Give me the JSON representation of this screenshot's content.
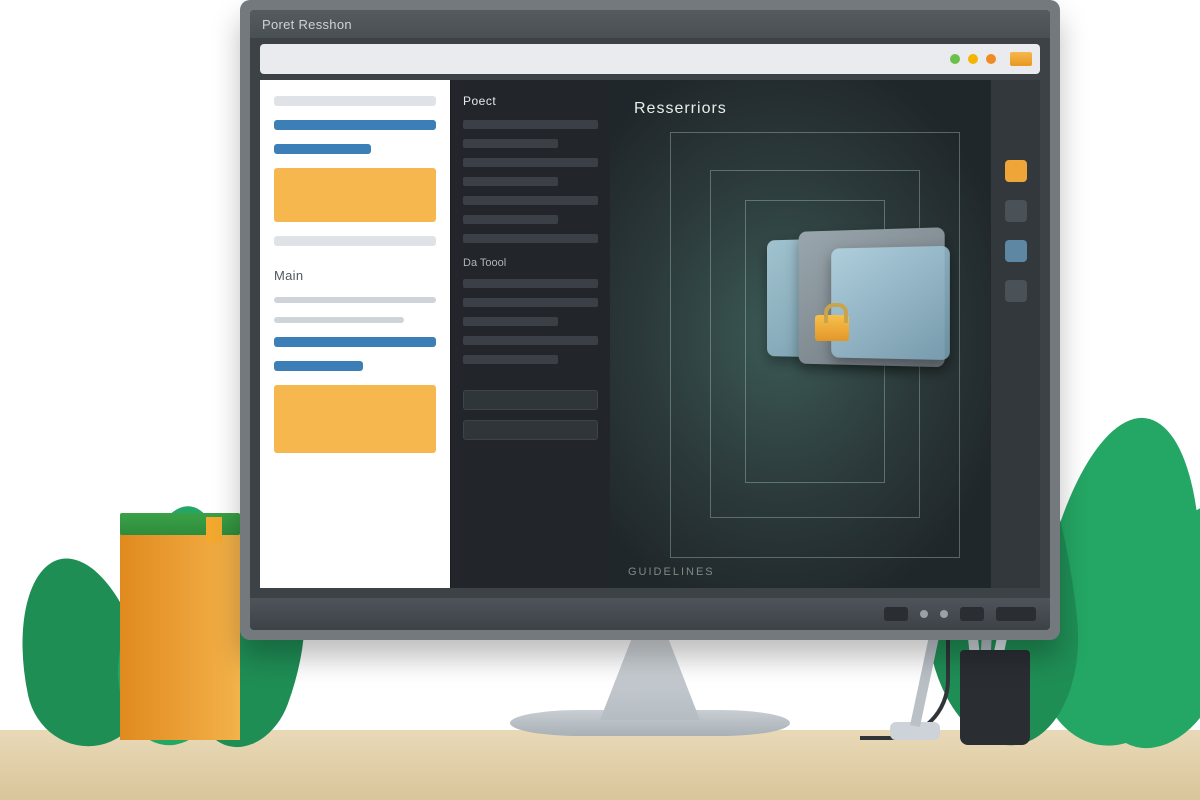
{
  "window": {
    "title": "Poret Resshon"
  },
  "sidebar_light": {
    "section_label": "Main"
  },
  "sidebar_dark": {
    "heading_top": "Poect",
    "heading_mid": "Da Toool"
  },
  "canvas": {
    "title": "Resserriors",
    "footer": "GUIDELINES"
  },
  "swatches": [
    "#f0a538",
    "#4a5157",
    "#5e87a3",
    "#4a5157"
  ]
}
